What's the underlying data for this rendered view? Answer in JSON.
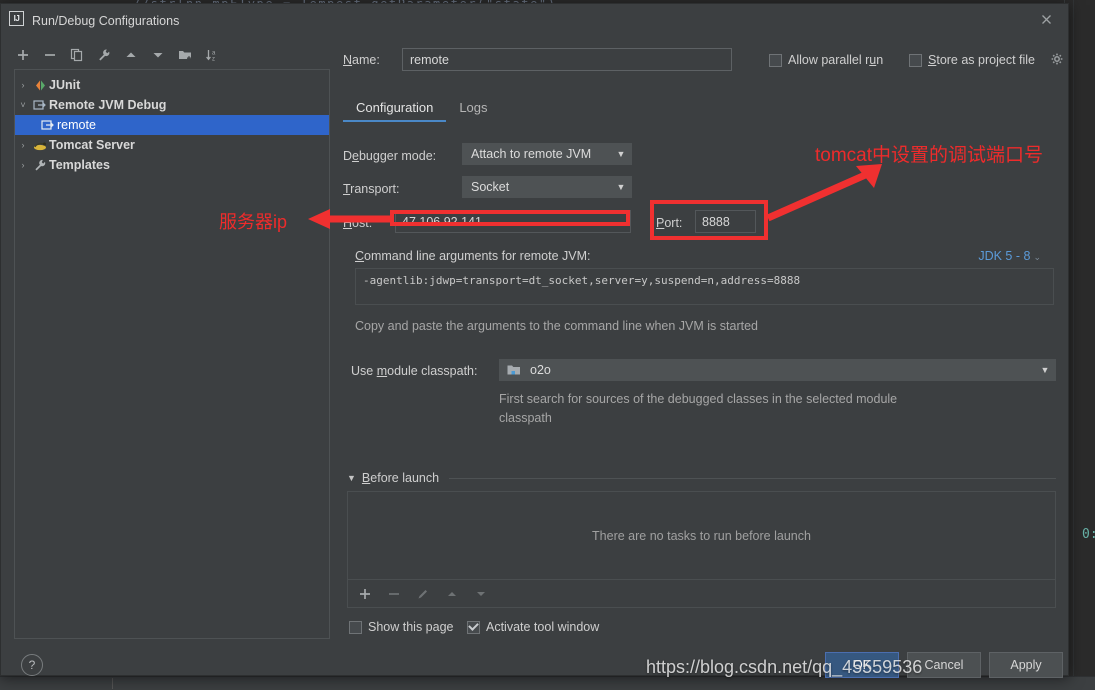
{
  "background": {
    "code_top": "//strlnn  mpEType = Tempest.getParameter(\"state\")",
    "code_right": "0:",
    "accent": "#4a88c7"
  },
  "dialog": {
    "title": "Run/Debug Configurations",
    "app_icon_text": "IJ",
    "close_icon": "close-icon"
  },
  "tree_toolbar": {
    "items": [
      {
        "name": "add-configuration-button",
        "icon": "plus-icon"
      },
      {
        "name": "remove-configuration-button",
        "icon": "minus-icon"
      },
      {
        "name": "copy-configuration-button",
        "icon": "copy-icon"
      },
      {
        "name": "edit-templates-button",
        "icon": "wrench-icon"
      },
      {
        "name": "move-up-button",
        "icon": "arrow-up-icon"
      },
      {
        "name": "move-down-button",
        "icon": "arrow-down-icon"
      },
      {
        "name": "new-folder-button",
        "icon": "folder-add-icon"
      },
      {
        "name": "sort-button",
        "icon": "sort-az-icon"
      }
    ]
  },
  "tree": {
    "items": [
      {
        "label": "JUnit",
        "icon": "junit-icon",
        "arrow": "›",
        "expanded": false,
        "selected": false,
        "child": false
      },
      {
        "label": "Remote JVM Debug",
        "icon": "remote-debug-icon",
        "arrow": "˅",
        "expanded": true,
        "selected": false,
        "child": false
      },
      {
        "label": "remote",
        "icon": "remote-debug-icon",
        "arrow": "",
        "expanded": false,
        "selected": true,
        "child": true
      },
      {
        "label": "Tomcat Server",
        "icon": "tomcat-icon",
        "arrow": "›",
        "expanded": false,
        "selected": false,
        "child": false
      },
      {
        "label": "Templates",
        "icon": "wrench-icon",
        "arrow": "›",
        "expanded": false,
        "selected": false,
        "child": false
      }
    ]
  },
  "form": {
    "name_label_pre": "N",
    "name_label_mnemonic": "a",
    "name_label_post": "me:",
    "name_value": "remote",
    "name_placeholder": "",
    "allow_parallel_run": {
      "label_pre": "Allow parallel r",
      "label_mnemonic": "u",
      "label_post": "n",
      "checked": false
    },
    "store_as_project_file": {
      "label": "Store as project file",
      "checked": false
    },
    "gear_icon": "gear-icon",
    "tabs": [
      {
        "label": "Configuration",
        "active": true
      },
      {
        "label": "Logs",
        "active": false
      }
    ],
    "debugger_mode": {
      "label_pre": "D",
      "label_mnemonic": "e",
      "label_post": "bugger mode:",
      "value": "Attach to remote JVM"
    },
    "transport": {
      "label_pre": "",
      "label_mnemonic": "T",
      "label_post": "ransport:",
      "value": "Socket"
    },
    "host": {
      "label_pre": "",
      "label_mnemonic": "H",
      "label_post": "ost:",
      "value": "47.106.92.141"
    },
    "port": {
      "label_pre": "",
      "label_mnemonic": "P",
      "label_post": "ort:",
      "value": "8888"
    },
    "cmdline": {
      "label_pre": "",
      "label_mnemonic": "C",
      "label_post": "ommand line arguments for remote JVM:",
      "value": "-agentlib:jdwp=transport=dt_socket,server=y,suspend=n,address=8888",
      "jdk_label": "JDK 5 - 8",
      "hint": "Copy and paste the arguments to the command line when JVM is started"
    },
    "classpath": {
      "label_pre": "Use ",
      "label_mnemonic": "m",
      "label_post": "odule classpath:",
      "value": "o2o",
      "module_icon": "module-icon",
      "hint": "First search for sources of the debugged classes in the selected module classpath"
    },
    "before_launch": {
      "label_pre": "",
      "label_mnemonic": "B",
      "label_post": "efore launch",
      "empty_text": "There are no tasks to run before launch",
      "toolbar": [
        {
          "name": "add-task-button",
          "icon": "plus-icon",
          "disabled": false
        },
        {
          "name": "remove-task-button",
          "icon": "minus-icon",
          "disabled": true
        },
        {
          "name": "edit-task-button",
          "icon": "pencil-icon",
          "disabled": true
        },
        {
          "name": "move-task-up-button",
          "icon": "arrow-up-icon",
          "disabled": true
        },
        {
          "name": "move-task-down-button",
          "icon": "arrow-down-icon",
          "disabled": true
        }
      ]
    },
    "show_this_page": {
      "label": "Show this page",
      "checked": false
    },
    "activate_tool_window": {
      "label": "Activate tool window",
      "checked": true
    }
  },
  "footer": {
    "help_label": "?",
    "ok_label": "OK",
    "cancel_label": "Cancel",
    "apply_label": "Apply"
  },
  "annotations": {
    "color": "#ee2b2b",
    "host_note": "服务器ip",
    "port_note": "tomcat中设置的调试端口号"
  },
  "watermark": {
    "text": "https://blog.csdn.net/qq_45559536"
  }
}
